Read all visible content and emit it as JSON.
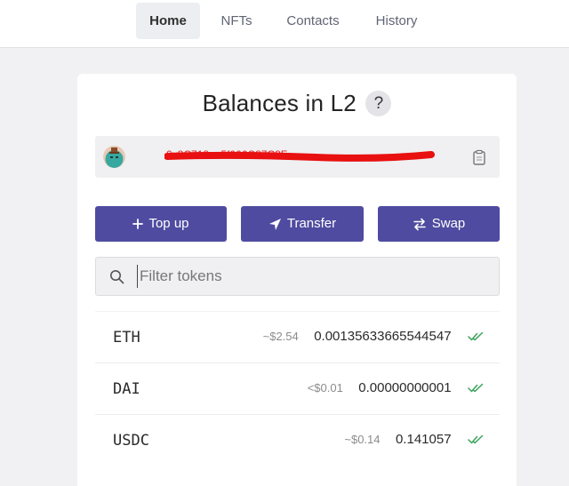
{
  "nav": {
    "items": [
      {
        "label": "Home"
      },
      {
        "label": "NFTs"
      },
      {
        "label": "Contacts"
      },
      {
        "label": "History"
      }
    ]
  },
  "card": {
    "title": "Balances in L2",
    "help_label": "?",
    "address": "0x8C718ee5f006C87C8F...",
    "actions": {
      "topup_label": "Top up",
      "transfer_label": "Transfer",
      "swap_label": "Swap"
    },
    "search": {
      "placeholder": "Filter tokens",
      "value": ""
    },
    "tokens": [
      {
        "symbol": "ETH",
        "usd": "~$2.54",
        "amount": "0.00135633665544547"
      },
      {
        "symbol": "DAI",
        "usd": "<$0.01",
        "amount": "0.00000000001"
      },
      {
        "symbol": "USDC",
        "usd": "~$0.14",
        "amount": "0.141057"
      }
    ]
  },
  "colors": {
    "accent": "#4f4ba0",
    "verified": "#3aa35a",
    "redaction": "#e81010"
  }
}
